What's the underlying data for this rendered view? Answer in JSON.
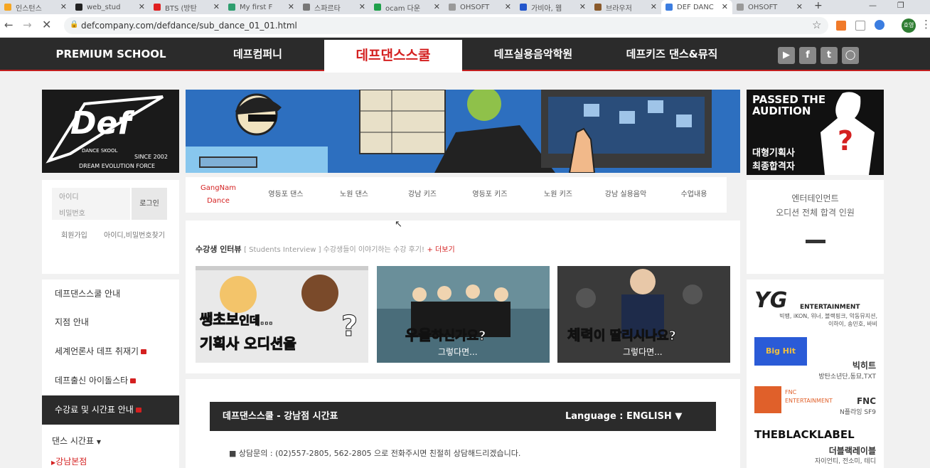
{
  "browser": {
    "tabs": [
      {
        "title": "인스턴스",
        "color": "#f5a623",
        "icon": "folder-icon"
      },
      {
        "title": "web_stud",
        "color": "#222222",
        "icon": "github-icon"
      },
      {
        "title": "BTS (방탄",
        "color": "#e02020",
        "icon": "youtube-icon"
      },
      {
        "title": "My first F",
        "color": "#2e9e6f",
        "icon": "v-icon"
      },
      {
        "title": "스파르타",
        "color": "#777777",
        "icon": "book-icon"
      },
      {
        "title": "ocam 다운",
        "color": "#1fa04a",
        "icon": "naver-icon"
      },
      {
        "title": "OHSOFT",
        "color": "#999999",
        "icon": "globe-icon"
      },
      {
        "title": "가비아, 웹",
        "color": "#2255cc",
        "icon": "gabia-icon"
      },
      {
        "title": "브라우저",
        "color": "#8a5a2b",
        "icon": "bear-icon"
      },
      {
        "title": "DEF DANC",
        "color": "#3b7de0",
        "icon": "page-icon"
      },
      {
        "title": "OHSOFT",
        "color": "#999999",
        "icon": "globe-icon"
      }
    ],
    "new_tab": "+",
    "url": "defcompany.com/defdance/sub_dance_01_01.html",
    "profile": "호영"
  },
  "site_nav": {
    "items": [
      "PREMIUM SCHOOL",
      "데프컴퍼니",
      "데프댄스스쿨",
      "데프실용음악학원",
      "데프키즈 댄스&뮤직"
    ],
    "active_index": 2,
    "social": [
      "youtube-icon",
      "facebook-icon",
      "twitter-icon",
      "instagram-icon"
    ]
  },
  "logo": {
    "brand": "Def",
    "sub": "DANCE SKOOL",
    "since": "SINCE 2002",
    "tagline": "DREAM  EVOLUTION  FORCE"
  },
  "login": {
    "id_placeholder": "아이디",
    "pw_placeholder": "비밀번호",
    "button": "로그인",
    "join": "회원가입",
    "find": "아이디,비밀번호찾기"
  },
  "side_menu": {
    "items": [
      {
        "label": "데프댄스스쿨 안내",
        "badge": false
      },
      {
        "label": "지점 안내",
        "badge": false
      },
      {
        "label": "세계언론사 데프 취재기",
        "badge": true
      },
      {
        "label": "데프출신 아이돌스타",
        "badge": true
      },
      {
        "label": "수강료 및 시간표 안내",
        "badge": true
      }
    ],
    "active_index": 4,
    "sub_heading": "댄스 시간표",
    "sub_item": "강남본점"
  },
  "sub_nav": {
    "items": [
      "GangNam\nDance",
      "영등포 댄스",
      "노원 댄스",
      "강남 키즈",
      "영등포 키즈",
      "노원 키즈",
      "강남 실용음악",
      "수업내용"
    ],
    "active_index": 0
  },
  "interview": {
    "title": "수강생 인터뷰",
    "sub": "[ Students Interview ] 수강생들이 이야기하는 수강 후기!",
    "more": "+ 더보기",
    "thumbs": [
      {
        "line1_red": "쌩초보",
        "line1": "인데...",
        "line2": "기획사 오디션을",
        "tail": "?"
      },
      {
        "line1_red": "우울",
        "line1": "하신가요?",
        "line2": "그렇다면..."
      },
      {
        "line1_red": "체력",
        "line1": "이 딸리시나요?",
        "line2": "그렇다면..."
      }
    ]
  },
  "schedule": {
    "title": "데프댄스스쿨 - 강남점 시간표",
    "language_label": "Language : ENGLISH ▼",
    "note": "■  상담문의 : (02)557-2805, 562-2805 으로 전화주시면 친절히 상담해드리겠습니다."
  },
  "audition": {
    "title": "PASSED THE\nAUDITION",
    "line1": "대형기획사",
    "line2": "최종합격자",
    "mark": "?"
  },
  "enter": {
    "line1": "엔터테인먼트",
    "line2": "오디션 전체 합격 인원"
  },
  "agencies": [
    {
      "logo": "YG",
      "sub": "ENTERTAINMENT",
      "desc": "빅뱅, iKON, 위너, 블랙핑크, 악동뮤지션,\n이하이, 송민호, 바비"
    },
    {
      "logo": "Big Hit",
      "name": "빅히트",
      "desc": "방탄소년단,동묘,TXT"
    },
    {
      "logo": "FNC\nENTERTAINMENT",
      "name": "FNC",
      "desc": "N플라잉 SF9"
    },
    {
      "logo": "THEBLACKLABEL",
      "name": "더블랙레이블",
      "desc": "자이언티, 전소미, 테디"
    }
  ]
}
